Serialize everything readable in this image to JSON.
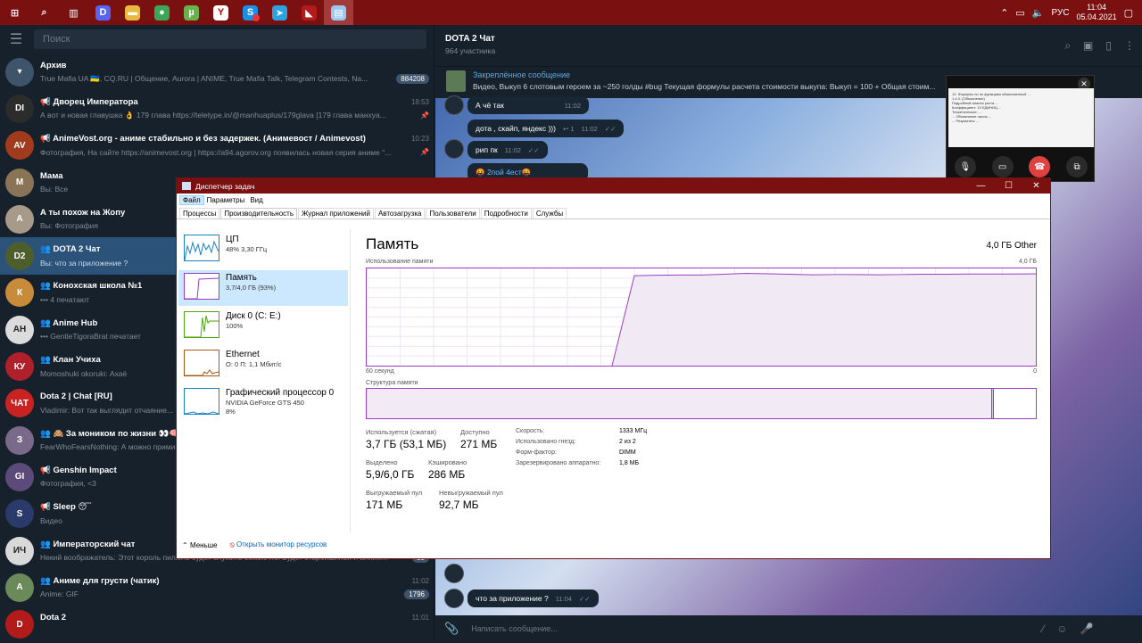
{
  "taskbar": {
    "icons": [
      {
        "name": "start-icon",
        "glyph": "⊞",
        "color": "transparent"
      },
      {
        "name": "search-icon",
        "glyph": "⌕",
        "color": "transparent"
      },
      {
        "name": "taskview-icon",
        "glyph": "▥",
        "color": "transparent"
      },
      {
        "name": "discord-icon",
        "glyph": "D",
        "color": "#5865f2"
      },
      {
        "name": "explorer-icon",
        "glyph": "▬",
        "color": "#e8b842"
      },
      {
        "name": "chrome-icon",
        "glyph": "●",
        "color": "#3aa757"
      },
      {
        "name": "utorrent-icon",
        "glyph": "µ",
        "color": "#6ab04c"
      },
      {
        "name": "yandex-icon",
        "glyph": "Y",
        "color": "#ffffff"
      },
      {
        "name": "skype-icon",
        "glyph": "S",
        "color": "#1a8fe3"
      },
      {
        "name": "telegram-icon",
        "glyph": "➤",
        "color": "#2aa3e0"
      },
      {
        "name": "dota-icon",
        "glyph": "◣",
        "color": "#b31b1b"
      },
      {
        "name": "taskmanager-icon",
        "glyph": "▤",
        "color": "#9ec7ee"
      }
    ],
    "lang": "РУС",
    "time": "11:04",
    "date": "05.04.2021"
  },
  "sidebar": {
    "search_placeholder": "Поиск",
    "chats": [
      {
        "title": "Архив",
        "msg": "True Mafia UA 🇺🇦, CQ.RU | Общение, Aurora | ANIME, True Mafia Talk, Telegram Contests, Na...",
        "time": "",
        "unread": "884208",
        "ava": "#3e546a",
        "ava_text": "▾"
      },
      {
        "title": "📢 Дворец Императора",
        "msg": "А вот и новая главушка 👌 179 глава https://teletype.in/@manhuaplus/179glava [179 глава манхуа...",
        "time": "18:53",
        "unread": "",
        "ava": "#2c2c2c",
        "ava_text": "DI"
      },
      {
        "title": "📢 AnimeVost.org - аниме стабильно и без задержек. (Анимевост / Animevost)",
        "msg": "Фотография, На сайте https://animevost.org | https://a94.agorov.org появилась новая серия аниме \"...",
        "time": "10:23",
        "unread": "",
        "ava": "#a23b1e",
        "ava_text": "AV"
      },
      {
        "title": "Мама",
        "msg": "Вы: Все",
        "time": "",
        "unread": "",
        "ava": "#8a7356",
        "ava_text": "М"
      },
      {
        "title": "А ты похож на Жопу",
        "msg": "Вы: Фотография",
        "time": "",
        "unread": "",
        "ava": "#a89a88",
        "ava_text": "А"
      },
      {
        "title": "👥 DOTA 2 Чат",
        "msg": "Вы: что за приложение ?",
        "time": "",
        "unread": "",
        "ava": "#4e5d2c",
        "ava_text": "D2"
      },
      {
        "title": "👥 Коноxская школа №1",
        "msg": "••• 4 печатают",
        "time": "",
        "unread": "",
        "ava": "#c88b3a",
        "ava_text": "К"
      },
      {
        "title": "👥 Anime Hub",
        "msg": "••• GentleTigoraBrat печатает",
        "time": "",
        "unread": "",
        "ava": "#dcdcdc",
        "ava_text": "AH"
      },
      {
        "title": "👥 Клан Учиха",
        "msg": "Momoshuki okorukі: Ахаё",
        "time": "",
        "unread": "",
        "ava": "#b0202a",
        "ava_text": "КУ"
      },
      {
        "title": "Dota 2 | Chat [RU]",
        "msg": "Vladimir: Вот так выглядит отчаяние...",
        "time": "",
        "unread": "",
        "ava": "#c92222",
        "ava_text": "ЧАТ"
      },
      {
        "title": "👥 🙈 За моником по жизни 👀🧠",
        "msg": "FearWhoFearsNothing: А можно прими...",
        "time": "",
        "unread": "",
        "ava": "#7a6a8a",
        "ava_text": "З"
      },
      {
        "title": "📢 Genshin Impact",
        "msg": "Фотография, <3",
        "time": "",
        "unread": "",
        "ava": "#5b4a7a",
        "ava_text": "GI"
      },
      {
        "title": "📢 Sleep 😴",
        "msg": "Видео",
        "time": "",
        "unread": "",
        "ava": "#2a3a6a",
        "ava_text": "S"
      },
      {
        "title": "👥 Императорский чат",
        "msg": "Некий воображатель: Этот король пилюль будет служить семью ло. Будет старейшиной и алхим...",
        "time": "11:03",
        "unread": "35",
        "ava": "#d9d9d9",
        "ava_text": "ИЧ"
      },
      {
        "title": "👥 Аниме для грусти (чатик)",
        "msg": "Anime: GIF",
        "time": "11:02",
        "unread": "1796",
        "ava": "#6b8a5a",
        "ava_text": "А"
      },
      {
        "title": "Dota 2",
        "msg": "",
        "time": "11:01",
        "unread": "",
        "ava": "#b31b1b",
        "ava_text": "D"
      }
    ]
  },
  "chat": {
    "title": "DOTA 2 Чат",
    "subtitle": "964 участника",
    "pinned_title": "Закреплённое сообщение",
    "pinned_msg": "Видео, Выкуп 6 слотовым героем за ~250 голды #bug  Текущая формулы расчета стоимости выкупа: Выкуп = 100 + Общая стоим...",
    "messages": [
      {
        "text": "А чё так",
        "time": "11:02"
      },
      {
        "text": "дота , скайп, яндекс )))",
        "time": "11:02"
      },
      {
        "text": "рип пк",
        "time": "11:02"
      },
      {
        "text": "🤬 2пой 4ест🤬",
        "time": ""
      },
      {
        "text": "что за приложение ?",
        "time": "11:04"
      }
    ],
    "composer_placeholder": "Написать сообщение..."
  },
  "call": {
    "doc_lines": [
      "12. Формулы по по функциям обыкновенный ...",
      "1.4.3. (Объяснение)",
      "Подробный анализ роста ...",
      "Коэффициент: 10 ЕДИНИЦ ...",
      "Теоретическое: ...",
      "... Объявление числа ...",
      "... Результаты ..."
    ]
  },
  "taskmanager": {
    "title": "Диспетчер задач",
    "menu": [
      "Файл",
      "Параметры",
      "Вид"
    ],
    "tabs": [
      "Процессы",
      "Производительность",
      "Журнал приложений",
      "Автозагрузка",
      "Пользователи",
      "Подробности",
      "Службы"
    ],
    "resources": [
      {
        "name": "ЦП",
        "sub": "48% 3,30 ГГц",
        "sub2": "",
        "color": "#1782c4"
      },
      {
        "name": "Память",
        "sub": "3,7/4,0 ГБ (93%)",
        "sub2": "",
        "color": "#9b3dc4"
      },
      {
        "name": "Диск 0 (C: E:)",
        "sub": "100%",
        "sub2": "",
        "color": "#4da60c"
      },
      {
        "name": "Ethernet",
        "sub": "О: 0 П: 1,1 Мбит/с",
        "sub2": "",
        "color": "#a7590f"
      },
      {
        "name": "Графический процессор 0",
        "sub": "NVIDIA GeForce GTS 450",
        "sub2": "8%",
        "color": "#1782c4"
      }
    ],
    "heading": "Память",
    "mem_type": "4,0 ГБ Other",
    "usage_label": "Использование памяти",
    "usage_max": "4,0 ГБ",
    "axis_left": "60 секунд",
    "axis_right": "0",
    "structure_label": "Структура памяти",
    "stats": [
      {
        "k": "Используется (сжатая)",
        "v": "3,7 ГБ (53,1 МБ)"
      },
      {
        "k": "Доступно",
        "v": "271 МБ"
      },
      {
        "k": "Выделено",
        "v": "5,9/6,0 ГБ"
      },
      {
        "k": "Кэшировано",
        "v": "286 МБ"
      },
      {
        "k": "Выгружаемый пул",
        "v": "171 МБ"
      },
      {
        "k": "Невыгружаемый пул",
        "v": "92,7 МБ"
      }
    ],
    "details": [
      {
        "k": "Скорость:",
        "v": "1333 МГц"
      },
      {
        "k": "Использовано гнезд:",
        "v": "2 из 2"
      },
      {
        "k": "Форм-фактор:",
        "v": "DIMM"
      },
      {
        "k": "Зарезервировано аппаратно:",
        "v": "1,8 МБ"
      }
    ],
    "less": "Меньше",
    "monitor": "Открыть монитор ресурсов"
  },
  "chart_data": {
    "type": "area",
    "title": "Использование памяти",
    "x_range": [
      60,
      0
    ],
    "ylim": [
      0,
      4.0
    ],
    "x": [
      60,
      58,
      56,
      54,
      52,
      50,
      48,
      46,
      44,
      42,
      40,
      38,
      36,
      34,
      32,
      30,
      28,
      26,
      24,
      22,
      20,
      18,
      16,
      14,
      12,
      10,
      8,
      6,
      4,
      2,
      0
    ],
    "values": [
      0,
      0,
      0,
      0,
      0,
      0,
      0,
      0,
      0,
      0,
      0,
      0,
      3.7,
      3.72,
      3.73,
      3.73,
      3.76,
      3.8,
      3.78,
      3.76,
      3.74,
      3.75,
      3.75,
      3.74,
      3.75,
      3.76,
      3.76,
      3.77,
      3.77,
      3.77,
      3.78
    ]
  }
}
